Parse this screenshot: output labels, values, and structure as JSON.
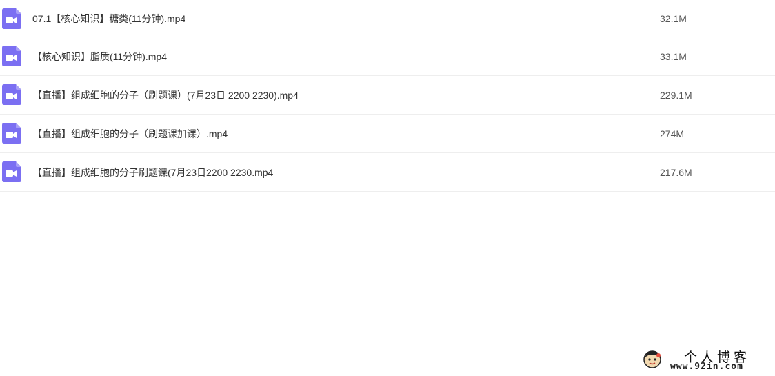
{
  "files": [
    {
      "name": "07.1【核心知识】糖类(11分钟).mp4",
      "size": "32.1M",
      "icon": "video-file-icon"
    },
    {
      "name": "【核心知识】脂质(11分钟).mp4",
      "size": "33.1M",
      "icon": "video-file-icon"
    },
    {
      "name": "【直播】组成细胞的分子（刷题课）(7月23日 2200 2230).mp4",
      "size": "229.1M",
      "icon": "video-file-icon"
    },
    {
      "name": "【直播】组成细胞的分子（刷题课加课）.mp4",
      "size": "274M",
      "icon": "video-file-icon"
    },
    {
      "name": "【直播】组成细胞的分子刷题课(7月23日2200 2230.mp4",
      "size": "217.6M",
      "icon": "video-file-icon"
    }
  ],
  "colors": {
    "icon_fill": "#7b6ff2",
    "row_divider": "#eeeeee",
    "text": "#333333"
  },
  "watermark": {
    "title": "个人博客",
    "url": "www.92in.com"
  }
}
